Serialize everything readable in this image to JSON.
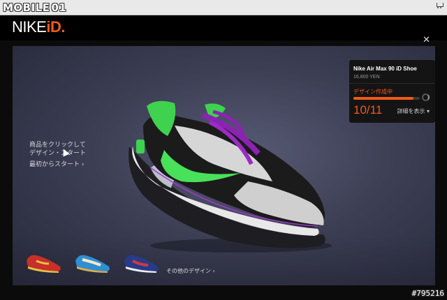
{
  "topbar": {
    "site_logo_text": "MOBILE",
    "site_logo_suffix": "01",
    "cart_icon": "cart-icon"
  },
  "brand": {
    "logo_main": "NIKE",
    "logo_accent": "iD.",
    "accent_color": "#f05a1a"
  },
  "stage": {
    "cta_line1": "商品をクリックして",
    "cta_line2": "デザイン・スタート",
    "cta_start": "最初からスタート ›",
    "more_designs": "その他のデザイン ›"
  },
  "panel": {
    "product_name": "Nike Air Max 90 iD Shoe",
    "price": "16,800 YEN",
    "status": "デザイン作成中",
    "progress": 0.91,
    "step": "10/11",
    "details_link": "詳細を表示 ▾"
  },
  "footer": {
    "watermark": "#795216"
  }
}
